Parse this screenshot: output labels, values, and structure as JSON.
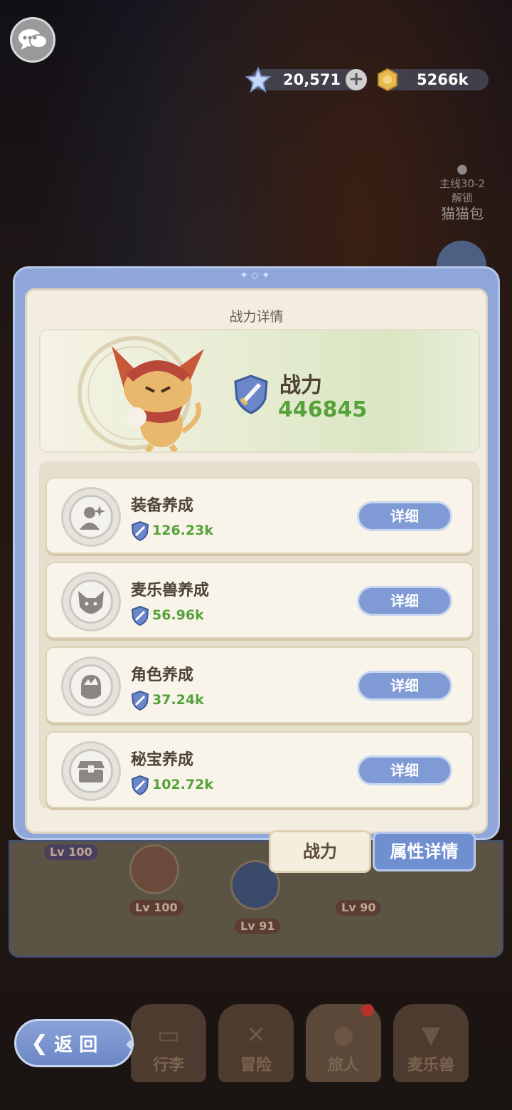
{
  "topbar": {
    "currency1": {
      "value": "20,571",
      "icon": "star-crystal-icon"
    },
    "currency2": {
      "value": "5266k",
      "icon": "gold-coin-icon"
    }
  },
  "side": {
    "lock_text": "主线30-2\n解锁",
    "lock_name": "猫猫包"
  },
  "panel": {
    "title": "战力详情",
    "power_label": "战力",
    "power_value": "446845",
    "rows": [
      {
        "title": "装备养成",
        "value": "126.23k",
        "button": "详细",
        "icon": "equipment-person-icon"
      },
      {
        "title": "麦乐兽养成",
        "value": "56.96k",
        "button": "详细",
        "icon": "cat-face-icon"
      },
      {
        "title": "角色养成",
        "value": "37.24k",
        "button": "详细",
        "icon": "character-head-icon"
      },
      {
        "title": "秘宝养成",
        "value": "102.72k",
        "button": "详细",
        "icon": "treasure-chest-icon"
      }
    ]
  },
  "tabs": {
    "power": "战力",
    "attributes": "属性详情"
  },
  "team": {
    "levels": [
      "Lv 100",
      "Lv 100",
      "Lv 91",
      "Lv 90"
    ]
  },
  "nav": {
    "back": "返 回",
    "items": [
      "行李",
      "冒险",
      "旅人",
      "麦乐兽"
    ]
  },
  "colors": {
    "accent": "#7f9ad4",
    "power_green": "#56a23a",
    "panel_bg": "#f2ede0"
  }
}
